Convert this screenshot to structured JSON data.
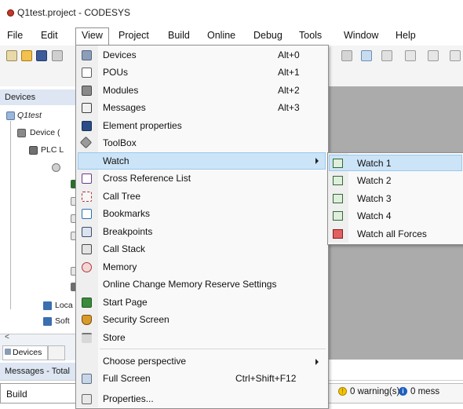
{
  "window": {
    "title": "Q1test.project - CODESYS"
  },
  "menubar": {
    "items": [
      "File",
      "Edit",
      "View",
      "Project",
      "Build",
      "Online",
      "Debug",
      "Tools",
      "Window",
      "Help"
    ],
    "active": "View"
  },
  "devices_panel": {
    "header": "Devices",
    "tree": [
      "Q1test",
      "Device (",
      "PLC L",
      "Loca",
      "Soft"
    ]
  },
  "bottom_tabs": {
    "devices": "Devices"
  },
  "messages_panel": {
    "header": "Messages - Total",
    "combo_value": "Build",
    "warnings": "0 warning(s)",
    "messages": "0 mess"
  },
  "view_menu": {
    "items": [
      {
        "label": "Devices",
        "shortcut": "Alt+0",
        "icon": "devices-icon"
      },
      {
        "label": "POUs",
        "shortcut": "Alt+1",
        "icon": "pous-icon"
      },
      {
        "label": "Modules",
        "shortcut": "Alt+2",
        "icon": "modules-icon"
      },
      {
        "label": "Messages",
        "shortcut": "Alt+3",
        "icon": "messages-icon"
      },
      {
        "label": "Element properties",
        "shortcut": "",
        "icon": "element-properties-icon"
      },
      {
        "label": "ToolBox",
        "shortcut": "",
        "icon": "toolbox-icon"
      },
      {
        "label": "Watch",
        "shortcut": "",
        "icon": "",
        "submenu": true,
        "highlighted": true
      },
      {
        "label": "Cross Reference List",
        "shortcut": "",
        "icon": "cross-reference-icon"
      },
      {
        "label": "Call Tree",
        "shortcut": "",
        "icon": "call-tree-icon"
      },
      {
        "label": "Bookmarks",
        "shortcut": "",
        "icon": "bookmarks-icon"
      },
      {
        "label": "Breakpoints",
        "shortcut": "",
        "icon": "breakpoints-icon"
      },
      {
        "label": "Call Stack",
        "shortcut": "",
        "icon": "call-stack-icon"
      },
      {
        "label": "Memory",
        "shortcut": "",
        "icon": "memory-icon"
      },
      {
        "label": "Online Change Memory Reserve Settings",
        "shortcut": "",
        "icon": ""
      },
      {
        "label": "Start Page",
        "shortcut": "",
        "icon": "start-page-icon"
      },
      {
        "label": "Security Screen",
        "shortcut": "",
        "icon": "security-screen-icon"
      },
      {
        "label": "Store",
        "shortcut": "",
        "icon": "store-icon"
      },
      {
        "label": "Choose perspective",
        "shortcut": "",
        "icon": "",
        "submenu": true
      },
      {
        "label": "Full Screen",
        "shortcut": "Ctrl+Shift+F12",
        "icon": "full-screen-icon"
      },
      {
        "label": "Properties...",
        "shortcut": "",
        "icon": "properties-icon"
      }
    ]
  },
  "watch_submenu": {
    "items": [
      {
        "label": "Watch 1",
        "highlighted": true
      },
      {
        "label": "Watch 2"
      },
      {
        "label": "Watch 3"
      },
      {
        "label": "Watch 4"
      },
      {
        "label": "Watch all Forces"
      }
    ]
  },
  "colors": {
    "highlight": "#cce4f7",
    "highlight_border": "#99c9ef",
    "workspace": "#ababab",
    "panel_header": "#dde6f2"
  }
}
